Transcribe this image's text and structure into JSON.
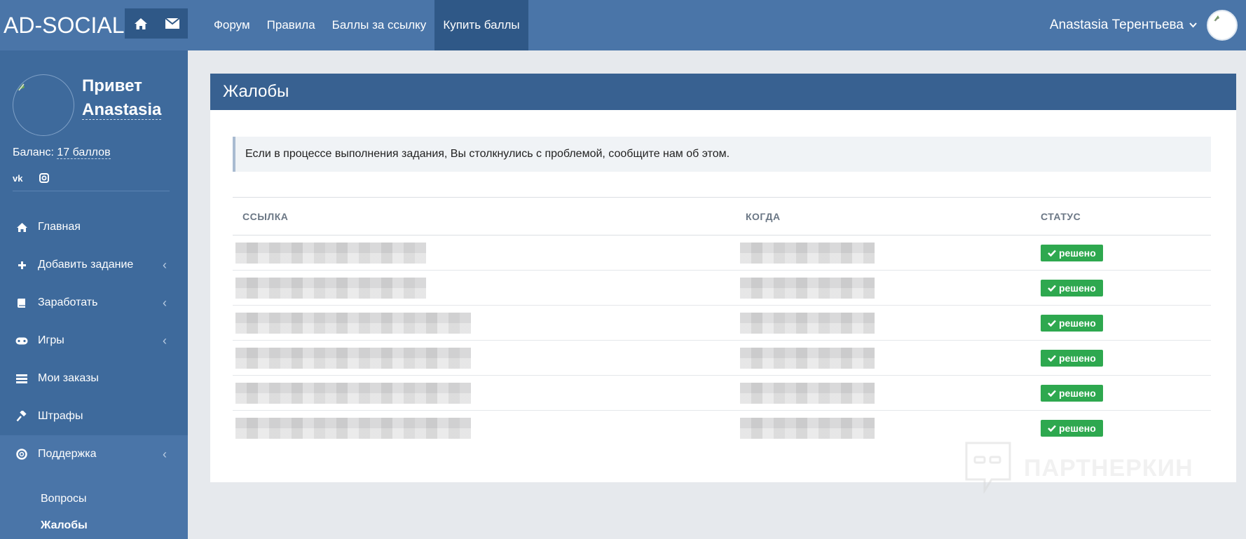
{
  "header": {
    "brand": "AD-SOCIAL",
    "quick_icons": [
      "home-icon",
      "envelope-icon"
    ],
    "nav": [
      {
        "label": "Форум"
      },
      {
        "label": "Правила"
      },
      {
        "label": "Баллы за ссылку"
      },
      {
        "label": "Купить баллы",
        "active": true
      }
    ],
    "user_name": "Anastasia Терентьева"
  },
  "sidebar": {
    "greeting_line1": "Привет",
    "greeting_name": "Anastasia",
    "balance_label": "Баланс:",
    "balance_value": "17 баллов",
    "socials": [
      "vk-icon",
      "instagram-icon"
    ],
    "menu": [
      {
        "label": "Главная",
        "icon": "home-icon"
      },
      {
        "label": "Добавить задание",
        "icon": "plus-icon",
        "has_children": true
      },
      {
        "label": "Заработать",
        "icon": "book-icon",
        "has_children": true
      },
      {
        "label": "Игры",
        "icon": "gamepad-icon",
        "has_children": true
      },
      {
        "label": "Мои заказы",
        "icon": "list-icon"
      },
      {
        "label": "Штрафы",
        "icon": "gavel-icon"
      },
      {
        "label": "Поддержка",
        "icon": "lifebuoy-icon",
        "has_children": true,
        "open": true
      }
    ],
    "submenu": [
      {
        "label": "Вопросы"
      },
      {
        "label": "Жалобы",
        "active": true
      }
    ]
  },
  "main": {
    "title": "Жалобы",
    "notice": "Если в процессе выполнения задания, Вы столкнулись с проблемой, сообщите нам об этом.",
    "columns": [
      "ССЫЛКА",
      "КОГДА",
      "СТАТУС"
    ],
    "rows": [
      {
        "status": "решено"
      },
      {
        "status": "решено"
      },
      {
        "status": "решено"
      },
      {
        "status": "решено"
      },
      {
        "status": "решено"
      },
      {
        "status": "решено"
      }
    ],
    "status_color": "#2ea84f"
  },
  "watermark": {
    "text": "ПАРТНЕРКИН"
  },
  "colors": {
    "topbar": "#4a75a8",
    "sidebar": "#3e6a9c",
    "panel_header": "#386191",
    "background": "#e6e9ed"
  }
}
